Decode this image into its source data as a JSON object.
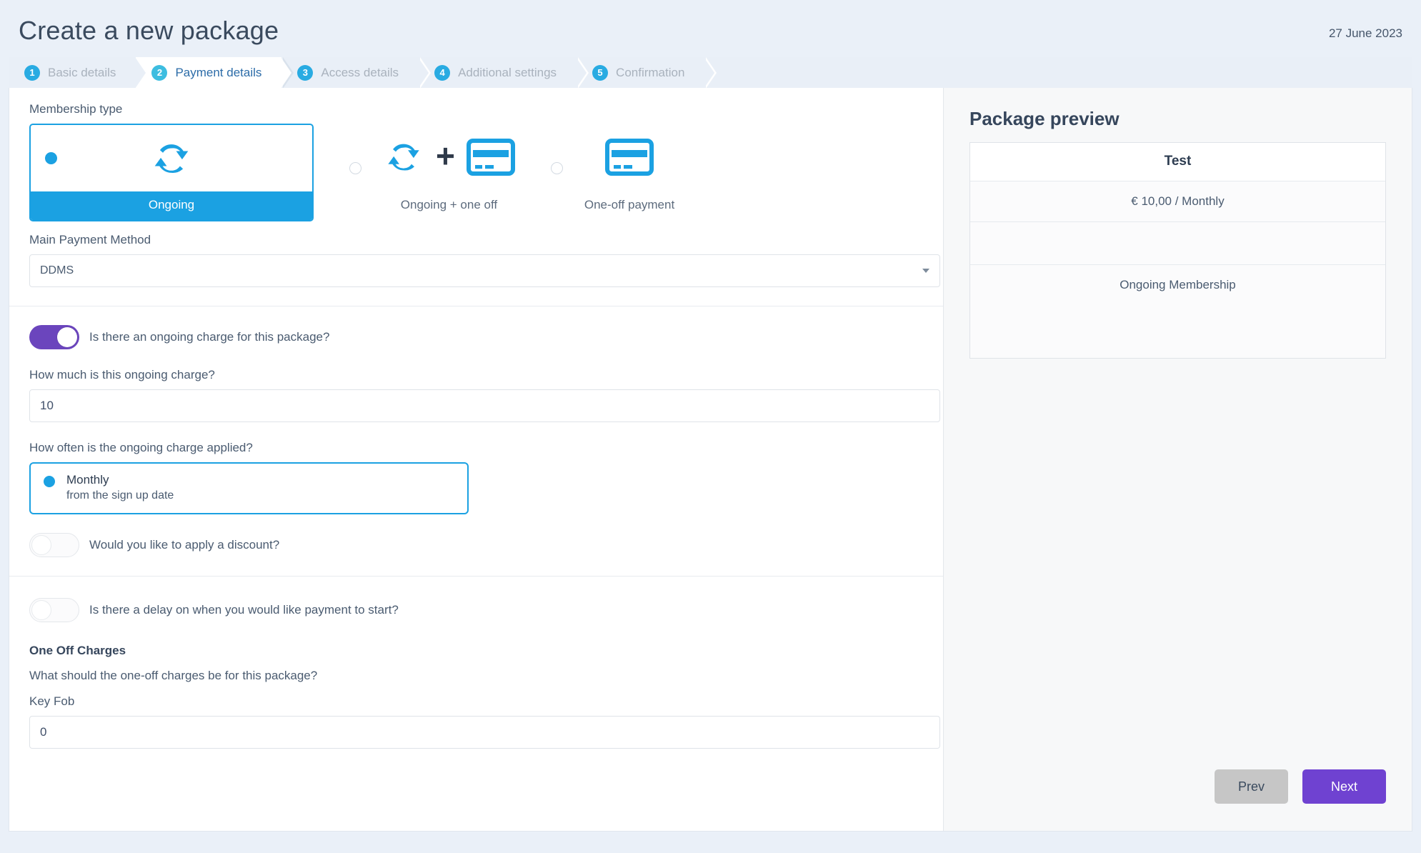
{
  "header": {
    "title": "Create a new package",
    "date": "27 June 2023"
  },
  "stepper": {
    "steps": [
      {
        "num": "1",
        "label": "Basic details",
        "active": false
      },
      {
        "num": "2",
        "label": "Payment details",
        "active": true
      },
      {
        "num": "3",
        "label": "Access details",
        "active": false
      },
      {
        "num": "4",
        "label": "Additional settings",
        "active": false
      },
      {
        "num": "5",
        "label": "Confirmation",
        "active": false
      }
    ]
  },
  "form": {
    "membership_type_label": "Membership type",
    "options": [
      {
        "label": "Ongoing",
        "icon": "refresh-icon",
        "selected": true
      },
      {
        "label": "Ongoing + one off",
        "icon": "refresh-plus-card-icon",
        "selected": false
      },
      {
        "label": "One-off payment",
        "icon": "credit-card-icon",
        "selected": false
      }
    ],
    "payment_method_label": "Main Payment Method",
    "payment_method_value": "DDMS",
    "ongoing_charge_toggle_label": "Is there an ongoing charge for this package?",
    "ongoing_charge_toggle_state": "on",
    "ongoing_amount_label": "How much is this ongoing charge?",
    "ongoing_amount_value": "10",
    "frequency_label": "How often is the ongoing charge applied?",
    "frequency_option_title": "Monthly",
    "frequency_option_sub": "from the sign up date",
    "discount_toggle_label": "Would you like to apply a discount?",
    "discount_toggle_state": "off",
    "delay_toggle_label": "Is there a delay on when you would like payment to start?",
    "delay_toggle_state": "off",
    "one_off_heading": "One Off Charges",
    "one_off_question": "What should the one-off charges be for this package?",
    "key_fob_label": "Key Fob",
    "key_fob_value": "0"
  },
  "preview": {
    "title": "Package preview",
    "package_name": "Test",
    "price_line": "€ 10,00 / Monthly",
    "blank_line": "",
    "type_line": "Ongoing Membership"
  },
  "footer": {
    "prev_label": "Prev",
    "next_label": "Next"
  },
  "colors": {
    "accent_blue": "#1ba1e2",
    "step_blue": "#29abe2",
    "toggle_purple": "#6b45bd",
    "next_purple": "#6f42d1",
    "prev_gray": "#c6c6c6",
    "page_bg": "#eaf0f8"
  }
}
